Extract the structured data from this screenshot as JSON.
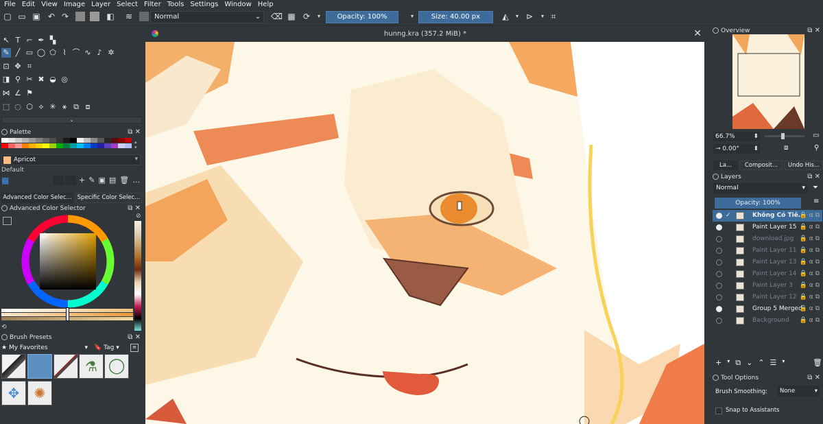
{
  "menu": [
    "File",
    "Edit",
    "View",
    "Image",
    "Layer",
    "Select",
    "Filter",
    "Tools",
    "Settings",
    "Window",
    "Help"
  ],
  "toolbar": {
    "blend_mode": "Normal",
    "opacity_label": "Opacity: 100%",
    "size_label": "Size: 40.00 px"
  },
  "document": {
    "title": "hunng.kra (357.2 MiB) *",
    "close_glyph": "✕"
  },
  "palette": {
    "title": "Palette",
    "color_name": "Apricot",
    "set_name": "Default",
    "colors": [
      "#ffffff",
      "#e6e6e6",
      "#cccccc",
      "#b3b3b3",
      "#999999",
      "#808080",
      "#666666",
      "#4d4d4d",
      "#333333",
      "#1a1a1a",
      "#000000",
      "#f2f2f2",
      "#bfbfbf",
      "#8c8c8c",
      "#595959",
      "#262626",
      "#5a0a0a",
      "#8b0000",
      "#c00000",
      "#ff0000",
      "#ff6060",
      "#ff9999",
      "#ff7f00",
      "#ffb000",
      "#ffd200",
      "#ffff00",
      "#a0d000",
      "#00b000",
      "#008040",
      "#00a0a0",
      "#00c0ff",
      "#0080ff",
      "#0040c0",
      "#2020a0",
      "#6040c0",
      "#a040c0",
      "#d0d0ff",
      "#b0c0ff"
    ]
  },
  "color_selector": {
    "tab_advanced": "Advanced Color Selec...",
    "tab_specific": "Specific Color Selec...",
    "title": "Advanced Color Selector"
  },
  "brush_presets": {
    "title": "Brush Presets",
    "favorites": "My Favorites",
    "tag_label": "Tag"
  },
  "overview": {
    "title": "Overview",
    "zoom": "66.7%",
    "rotation": "0.00°"
  },
  "right_tabs": [
    "La...",
    "Composit...",
    "Undo His..."
  ],
  "layers": {
    "title": "Layers",
    "blend_mode": "Normal",
    "opacity_label": "Opacity: 100%",
    "items": [
      {
        "name": "Không Có Tiê...",
        "visible": true,
        "selected": true
      },
      {
        "name": "Paint Layer 15",
        "visible": true,
        "selected": false
      },
      {
        "name": "download.jpg",
        "visible": false,
        "selected": false
      },
      {
        "name": "Paint Layer 11",
        "visible": false,
        "selected": false
      },
      {
        "name": "Paint Layer 13",
        "visible": false,
        "selected": false
      },
      {
        "name": "Paint Layer 14",
        "visible": false,
        "selected": false
      },
      {
        "name": "Paint Layer 3",
        "visible": false,
        "selected": false
      },
      {
        "name": "Paint Layer 12",
        "visible": false,
        "selected": false
      },
      {
        "name": "Group 5 Merged",
        "visible": true,
        "selected": false
      },
      {
        "name": "Background",
        "visible": false,
        "selected": false
      }
    ]
  },
  "tool_options": {
    "title": "Tool Options",
    "brush_smoothing_label": "Brush Smoothing:",
    "brush_smoothing_value": "None",
    "snap_label": "Snap to Assistants"
  }
}
